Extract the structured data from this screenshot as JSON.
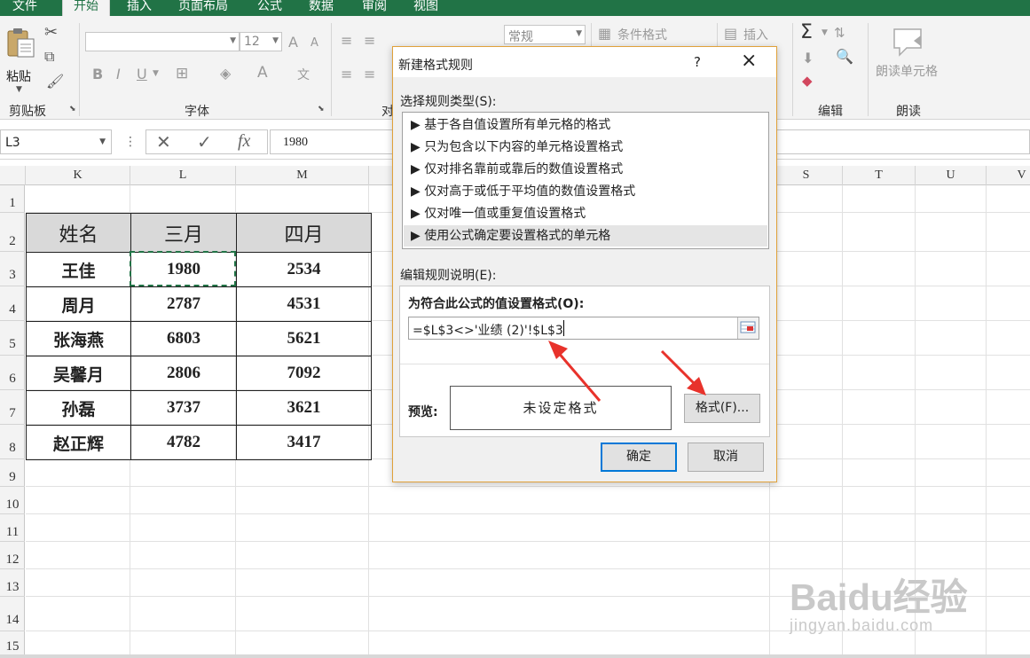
{
  "ribbon": {
    "tabs": [
      {
        "label": "文件"
      },
      {
        "label": "开始"
      },
      {
        "label": "插入"
      },
      {
        "label": "页面布局"
      },
      {
        "label": "公式"
      },
      {
        "label": "数据"
      },
      {
        "label": "审阅"
      },
      {
        "label": "视图"
      }
    ],
    "active_tab": "开始",
    "groups": {
      "clipboard": "剪贴板",
      "font": "字体",
      "alignment_partial": "对",
      "edit": "编辑",
      "read": "朗读"
    },
    "paste_label": "粘贴",
    "font_size": "12",
    "number_format": "常规",
    "conditional_format": "条件格式",
    "insert_label": "插入",
    "read_cell_label": "朗读单元格",
    "font_size_up": "A",
    "font_size_down": "A",
    "bold": "B",
    "italic": "I",
    "underline": "U",
    "font_color": "A"
  },
  "formula_bar": {
    "name_box": "L3",
    "formula": "1980"
  },
  "grid": {
    "columns": [
      "K",
      "L",
      "M",
      "S",
      "T",
      "U",
      "V"
    ],
    "rows": [
      "1",
      "2",
      "3",
      "4",
      "5",
      "6",
      "7",
      "8",
      "9",
      "10",
      "11",
      "12",
      "13",
      "14",
      "15"
    ],
    "table": {
      "headers": [
        "姓名",
        "三月",
        "四月"
      ],
      "data": [
        [
          "王佳",
          "1980",
          "2534"
        ],
        [
          "周月",
          "2787",
          "4531"
        ],
        [
          "张海燕",
          "6803",
          "5621"
        ],
        [
          "吴馨月",
          "2806",
          "7092"
        ],
        [
          "孙磊",
          "3737",
          "3621"
        ],
        [
          "赵正辉",
          "4782",
          "3417"
        ]
      ]
    }
  },
  "dialog": {
    "title": "新建格式规则",
    "help": "?",
    "select_rule_type_label": "选择规则类型(S):",
    "rule_types": [
      "基于各自值设置所有单元格的格式",
      "只为包含以下内容的单元格设置格式",
      "仅对排名靠前或靠后的数值设置格式",
      "仅对高于或低于平均值的数值设置格式",
      "仅对唯一值或重复值设置格式",
      "使用公式确定要设置格式的单元格"
    ],
    "selected_rule_index": 5,
    "edit_rule_label": "编辑规则说明(E):",
    "formula_label": "为符合此公式的值设置格式(O):",
    "formula_value": "=$L$3<>'业绩 (2)'!$L$3",
    "preview_label": "预览:",
    "preview_text": "未设定格式",
    "format_button": "格式(F)...",
    "ok_button": "确定",
    "cancel_button": "取消"
  },
  "annotation_color": "#e8322b",
  "accent_color": "#217346",
  "watermark": {
    "brand": "Baidu经验",
    "url": "jingyan.baidu.com"
  }
}
